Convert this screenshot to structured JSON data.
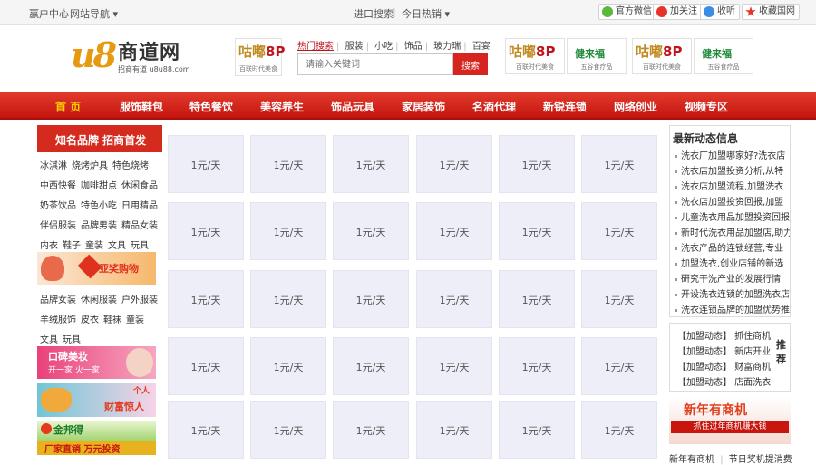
{
  "topbar": {
    "left": [
      "赢户中心",
      "网站导航 ▾"
    ],
    "center": [
      "进口搜索",
      "今日热销 ▾"
    ],
    "buttons": [
      "官方微信",
      "加关注",
      "收听",
      "收藏国网"
    ],
    "colors": {
      "wechat": "#5ab83a",
      "weibo": "#e5352a",
      "qq": "#3a8ee6",
      "fav": "#e5352a"
    }
  },
  "logo": {
    "mark": "u8",
    "name": "商道网",
    "sub": "招商有道 u8u88.com"
  },
  "header_brands": [
    {
      "big": "咕嘟",
      "accent": "8P",
      "cap": "百联时代美食"
    },
    {
      "big": "咕嘟",
      "accent": "8P",
      "cap": "百联时代美食"
    },
    {
      "big": "健来福",
      "accent": "",
      "cap": "五谷食疗品"
    },
    {
      "big": "咕嘟",
      "accent": "8P",
      "cap": "百联时代美食"
    },
    {
      "big": "健来福",
      "accent": "",
      "cap": "五谷食疗品"
    }
  ],
  "hotlinks": {
    "label": "热门搜索",
    "items": [
      "服装",
      "小吃",
      "饰品",
      "玻力瑞",
      "百宴"
    ]
  },
  "search": {
    "placeholder": "请输入关键词",
    "button": "搜索"
  },
  "nav": [
    "首 页",
    "服饰鞋包",
    "特色餐饮",
    "美容养生",
    "饰品玩具",
    "家居装饰",
    "名酒代理",
    "新锐连锁",
    "网络创业",
    "视频专区"
  ],
  "left": {
    "title": "知名品牌 招商首发",
    "rows1": [
      [
        "冰淇淋",
        "烧烤炉具",
        "特色烧烤"
      ],
      [
        "中西快餐",
        "咖啡甜点",
        "休闲食品"
      ],
      [
        "奶茶饮品",
        "特色小吃",
        "日用精品"
      ],
      [
        "伴侣服装",
        "品牌男装",
        "精品女装"
      ],
      [
        "内衣",
        "鞋子",
        "童装",
        "文具",
        "玩具"
      ]
    ],
    "banner1": "亚奖购物",
    "rows2": [
      [
        "品牌女装",
        "休闲服装",
        "户外服装"
      ],
      [
        "羊绒服饰",
        "皮衣",
        "鞋袜",
        "童装"
      ],
      [
        "文具",
        "玩具"
      ]
    ],
    "banners": [
      {
        "t1": "口碑美妆",
        "t2": "开一家 火一家"
      },
      {
        "t1": "财富惊人",
        "t2": "个人"
      },
      {
        "t1": "金邦得",
        "t2": "厂家直销 万元投资"
      }
    ]
  },
  "ad_grid": {
    "label": "1元/天",
    "rows": 5,
    "cols": 6
  },
  "right": {
    "news_title": "最新动态信息",
    "news": [
      "洗衣厂加盟哪家好?洗衣店",
      "洗衣店加盟投资分析,从特",
      "洗衣店加盟流程,加盟洗衣",
      "洗衣店加盟投资回报,加盟",
      "儿童洗衣用品加盟投资回报",
      "新时代洗衣用品加盟店,助力",
      "洗衣产品的连锁经营,专业",
      "加盟洗衣,创业店铺的新选",
      "研究干洗产业的发展行情",
      "开设洗衣连锁的加盟洗衣店",
      "洗衣连锁品牌的加盟优势推"
    ],
    "promo": [
      "【加盟动态】 抓住商机",
      "【加盟动态】 新店开业",
      "【加盟动态】 财富商机",
      "【加盟动态】 店面洗衣"
    ],
    "promo_side": "推荐",
    "banner": {
      "t1": "新年有商机",
      "t2": "抓住过年商机赚大钱"
    },
    "bottom_links": [
      "新年有商机",
      "节日奖机提消费"
    ]
  }
}
